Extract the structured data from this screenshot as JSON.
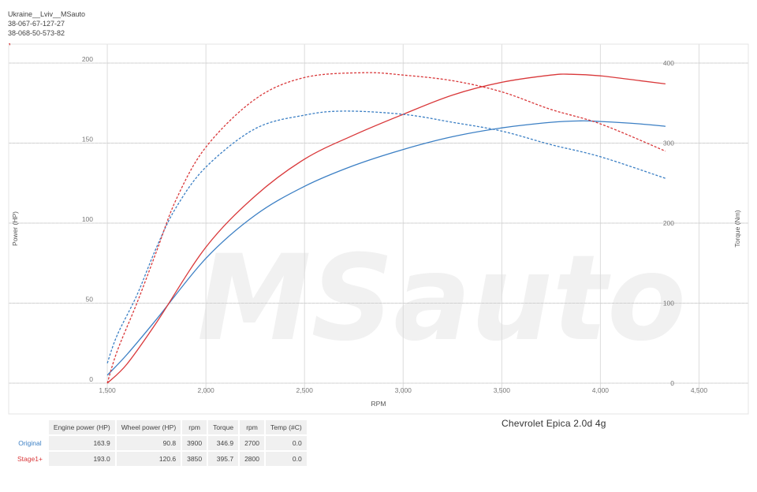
{
  "header": {
    "line1": "Ukraine__Lviv__MSauto",
    "line2": "38-067-67-127-27",
    "line3": "38-068-50-573-82"
  },
  "watermark": "MSauto",
  "colors": {
    "original": "#3b7fc4",
    "stage1": "#d9383a",
    "grid": "#d8d8d8"
  },
  "chart_data": {
    "type": "line",
    "title": "Chevrolet Epica 2.0d 4g",
    "xlabel": "RPM",
    "ylabel": "Power (HP)",
    "y2label": "Torque (Nm)",
    "xlim": [
      1000,
      4750
    ],
    "ylim": [
      0,
      200
    ],
    "y2lim": [
      0,
      400
    ],
    "xticks": [
      1500,
      2000,
      2500,
      3000,
      3500,
      4000,
      4500
    ],
    "xtick_labels": [
      "1,500",
      "2,000",
      "2,500",
      "3,000",
      "3,500",
      "4,000",
      "4,500"
    ],
    "yticks": [
      0,
      50,
      100,
      150,
      200
    ],
    "y2ticks": [
      0,
      100,
      200,
      300,
      400
    ],
    "grid": true,
    "series": [
      {
        "name": "Original",
        "measure": "power",
        "axis": "y",
        "dashed": false,
        "x": [
          1500,
          1600,
          1750,
          2000,
          2250,
          2500,
          2750,
          3000,
          3250,
          3500,
          3750,
          3900,
          4000,
          4200,
          4330
        ],
        "values": [
          5,
          18,
          40,
          78,
          105,
          123,
          136,
          146,
          154,
          159.5,
          163,
          163.9,
          163.5,
          162,
          160.5
        ]
      },
      {
        "name": "Stage1+",
        "measure": "power",
        "axis": "y",
        "dashed": false,
        "x": [
          1500,
          1600,
          1750,
          2000,
          2250,
          2500,
          2750,
          3000,
          3250,
          3500,
          3750,
          3850,
          4000,
          4200,
          4330
        ],
        "values": [
          0,
          12,
          38,
          85,
          117,
          140,
          155,
          168,
          180,
          188,
          192.5,
          193,
          192,
          189,
          187
        ]
      },
      {
        "name": "Original",
        "measure": "torque",
        "axis": "y2",
        "dashed": true,
        "x": [
          1500,
          1550,
          1650,
          1750,
          1850,
          2000,
          2250,
          2500,
          2700,
          3000,
          3250,
          3500,
          3750,
          4000,
          4330
        ],
        "values": [
          25,
          60,
          110,
          170,
          220,
          270,
          318,
          335,
          340,
          336,
          326,
          315,
          298,
          283,
          256
        ]
      },
      {
        "name": "Stage1+",
        "measure": "torque",
        "axis": "y2",
        "dashed": true,
        "x": [
          1500,
          1550,
          1650,
          1750,
          1850,
          2000,
          2250,
          2500,
          2800,
          3000,
          3250,
          3500,
          3750,
          4000,
          4330
        ],
        "values": [
          0,
          40,
          100,
          165,
          230,
          295,
          355,
          382,
          388,
          385,
          378,
          364,
          342,
          324,
          290
        ]
      }
    ]
  },
  "table": {
    "headers": [
      "Engine power (HP)",
      "Wheel power (HP)",
      "rpm",
      "Torque",
      "rpm",
      "Temp (#C)"
    ],
    "rows": [
      {
        "label": "Original",
        "cells": [
          "163.9",
          "90.8",
          "3900",
          "346.9",
          "2700",
          "0.0"
        ]
      },
      {
        "label": "Stage1+",
        "cells": [
          "193.0",
          "120.6",
          "3850",
          "395.7",
          "2800",
          "0.0"
        ]
      }
    ]
  }
}
